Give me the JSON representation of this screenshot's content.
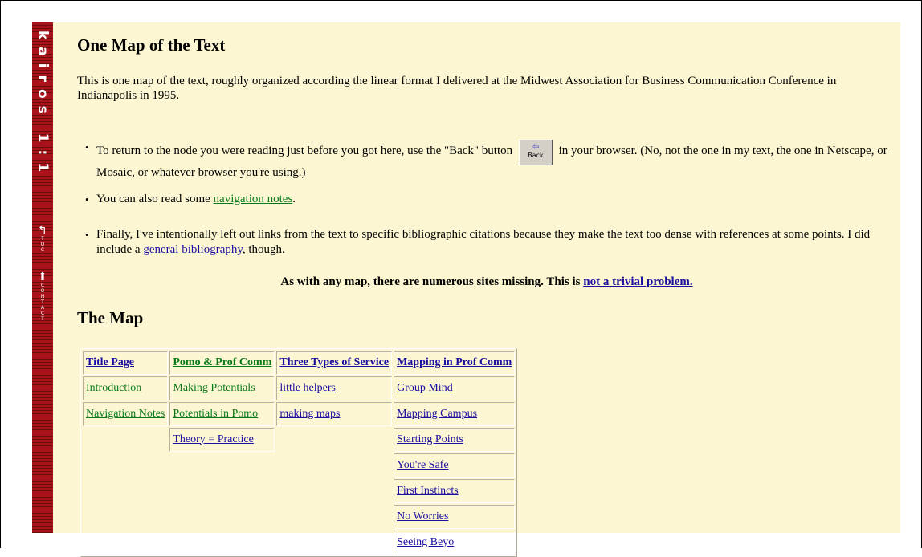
{
  "sidebar": {
    "logo_text": "kairos 1:1",
    "link_top": "TOC",
    "link_contact": "CONTACT",
    "link_top_icon": "curved-arrow-icon",
    "link_contact_icon": "up-arrow-icon"
  },
  "page": {
    "title": "One Map of the Text",
    "intro": "This is one map of the text, roughly organized according the linear format I delivered at the Midwest Association for Business Communication Conference in Indianapolis in 1995.",
    "bullets": {
      "b1_pre": "To return to the node you were reading just before you got here, use the \"Back\" button",
      "b1_post": "in your browser. (No, not the one in my text, the one in Netscape, or Mosaic, or whatever browser you're using.)",
      "back_button_label": "Back",
      "b2_pre": "You can also read some ",
      "b2_link": "navigation notes",
      "b2_post": ".",
      "b3_pre": "Finally, I've intentionally left out links from the text to specific bibliographic citations because they make the text too dense with references at some points. I did include a ",
      "b3_link": "general bibliography",
      "b3_post": ", though."
    },
    "note_pre": "As with any map, there are numerous sites missing. This is ",
    "note_link": "not a trivial problem.",
    "map_title": "The Map"
  },
  "map": {
    "columns": [
      {
        "header": "Title Page",
        "items": [
          "Introduction",
          "Navigation Notes"
        ]
      },
      {
        "header": "Pomo & Prof Comm",
        "items": [
          "Making Potentials",
          "Potentials in Pomo",
          "Theory = Practice"
        ]
      },
      {
        "header": "Three Types of Service",
        "items": [
          "little helpers",
          "making maps"
        ]
      },
      {
        "header": "Mapping in Prof Comm",
        "items": [
          "Group Mind",
          "Mapping Campus",
          "Starting Points",
          "You're Safe",
          "First Instincts",
          "No Worries",
          "Seeing Beyo"
        ]
      }
    ]
  },
  "colors": {
    "background": "#fcf7d2",
    "sidebar": "#a8131a",
    "link_visited": "#0a7a19",
    "link": "#1a0fa0"
  }
}
